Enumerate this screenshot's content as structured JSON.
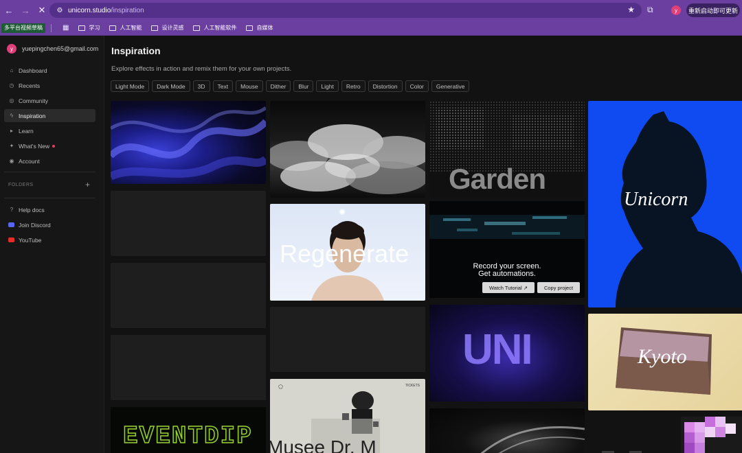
{
  "browser": {
    "url_host": "unicorn.studio",
    "url_path": "/inspiration",
    "profile_initial": "y",
    "update_label": "重新启动即可更新",
    "bookmarks": [
      "多平台视频草稿",
      "学习",
      "人工智能",
      "设计灵感",
      "人工智能软件",
      "自媒体"
    ],
    "accent_color": "#6b3fa0"
  },
  "sidebar": {
    "avatar_initial": "y",
    "email": "yuepingchen65@gmail.com",
    "nav": [
      {
        "label": "Dashboard",
        "icon": "home-icon"
      },
      {
        "label": "Recents",
        "icon": "clock-icon"
      },
      {
        "label": "Community",
        "icon": "globe-icon"
      },
      {
        "label": "Inspiration",
        "icon": "bolt-icon"
      },
      {
        "label": "Learn",
        "icon": "play-icon"
      },
      {
        "label": "What's New",
        "icon": "sparkle-icon"
      },
      {
        "label": "Account",
        "icon": "user-icon"
      }
    ],
    "folders_label": "FOLDERS",
    "help": [
      {
        "label": "Help docs",
        "icon": "question-icon"
      },
      {
        "label": "Join Discord",
        "icon": "discord-icon"
      },
      {
        "label": "YouTube",
        "icon": "youtube-icon"
      }
    ]
  },
  "main": {
    "title": "Inspiration",
    "subtitle": "Explore effects in action and remix them for your own projects.",
    "tags": [
      "Light Mode",
      "Dark Mode",
      "3D",
      "Text",
      "Mouse",
      "Dither",
      "Blur",
      "Light",
      "Retro",
      "Distortion",
      "Color",
      "Generative"
    ],
    "cards": {
      "regenerate_text": "Regenerate",
      "garden_text": "Garden",
      "record_line1": "Record your screen.",
      "record_line2": "Get automations.",
      "watch_tutorial": "Watch Tutorial ↗",
      "copy_project": "Copy project",
      "unicorn_text": "Unicorn",
      "uni_text": "UNI",
      "kyoto_text": "Kyoto",
      "eventdip_text": "EVENTDIP",
      "musee_text": "Musee Dr. M",
      "tickets_text": "TICKETS"
    }
  }
}
